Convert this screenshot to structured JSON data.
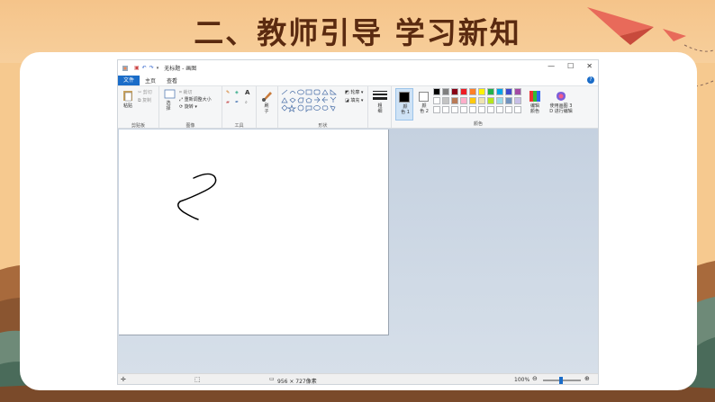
{
  "slide": {
    "title": "二、教师引导  学习新知"
  },
  "window": {
    "title": "无标题 - 画图",
    "minimize_icon": "minimize-icon",
    "maximize_icon": "maximize-icon",
    "close_icon": "close-icon"
  },
  "menu": {
    "file": "文件",
    "home": "主页",
    "view": "查看"
  },
  "ribbon": {
    "clipboard": {
      "paste": "粘贴",
      "cut": "剪切",
      "copy": "复制",
      "group": "剪贴板"
    },
    "image": {
      "select": "选\n择",
      "crop": "裁切",
      "resize": "重新调整大小",
      "rotate": "旋转",
      "group": "图像"
    },
    "tools": {
      "group": "工具"
    },
    "brushes": {
      "label": "刷\n子"
    },
    "shapes": {
      "outline": "轮廓",
      "fill": "填充",
      "group": "形状"
    },
    "size": {
      "label": "粗\n细"
    },
    "color1": {
      "label": "颜\n色 1"
    },
    "color2": {
      "label": "颜\n色 2"
    },
    "colors": {
      "group": "颜色",
      "edit": "编辑\n颜色",
      "paint3d": "使用画图 3\nD 进行编辑",
      "palette_row1": [
        "#000000",
        "#7f7f7f",
        "#880015",
        "#ed1c24",
        "#ff7f27",
        "#fff200",
        "#22b14c",
        "#00a2e8",
        "#3f48cc",
        "#a349a4"
      ],
      "palette_row2": [
        "#ffffff",
        "#c3c3c3",
        "#b97a57",
        "#ffaec9",
        "#ffc90e",
        "#efe4b0",
        "#b5e61d",
        "#99d9ea",
        "#7092be",
        "#c8bfe7"
      ],
      "palette_row3": [
        "#ffffff",
        "#ffffff",
        "#ffffff",
        "#ffffff",
        "#ffffff",
        "#ffffff",
        "#ffffff",
        "#ffffff",
        "#ffffff",
        "#ffffff"
      ]
    }
  },
  "status": {
    "dimensions": "956 × 727像素",
    "zoom": "100%"
  }
}
